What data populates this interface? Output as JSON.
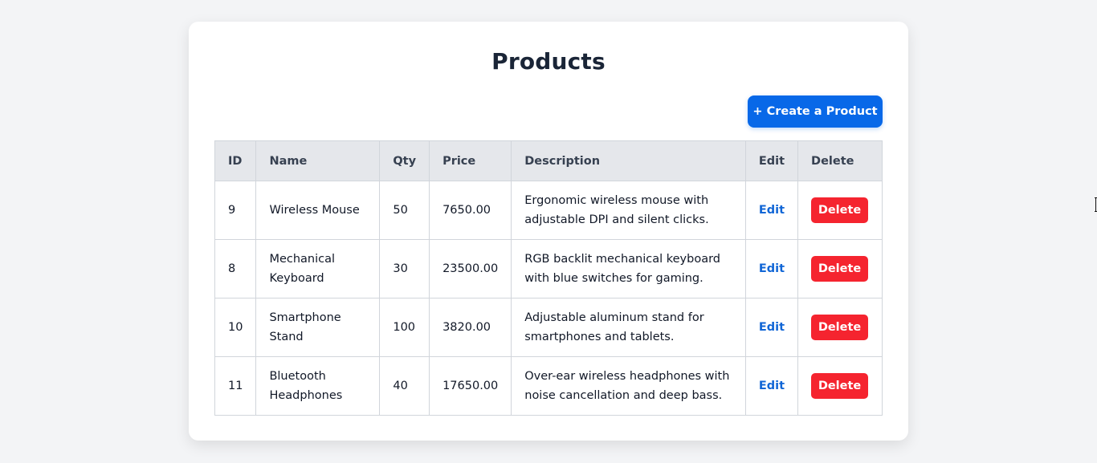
{
  "page": {
    "title": "Products",
    "create_button_label": "+ Create a Product"
  },
  "table": {
    "headers": [
      "ID",
      "Name",
      "Qty",
      "Price",
      "Description",
      "Edit",
      "Delete"
    ],
    "rows": [
      {
        "id": "9",
        "name": "Wireless Mouse",
        "qty": "50",
        "price": "7650.00",
        "description": "Ergonomic wireless mouse with adjustable DPI and silent clicks.",
        "edit_label": "Edit",
        "delete_label": "Delete"
      },
      {
        "id": "8",
        "name": "Mechanical Keyboard",
        "qty": "30",
        "price": "23500.00",
        "description": "RGB backlit mechanical keyboard with blue switches for gaming.",
        "edit_label": "Edit",
        "delete_label": "Delete"
      },
      {
        "id": "10",
        "name": "Smartphone Stand",
        "qty": "100",
        "price": "3820.00",
        "description": "Adjustable aluminum stand for smartphones and tablets.",
        "edit_label": "Edit",
        "delete_label": "Delete"
      },
      {
        "id": "11",
        "name": "Bluetooth Headphones",
        "qty": "40",
        "price": "17650.00",
        "description": "Over-ear wireless headphones with noise cancellation and deep bass.",
        "edit_label": "Edit",
        "delete_label": "Delete"
      }
    ]
  },
  "colors": {
    "page_background": "#f3f4f6",
    "card_background": "#ffffff",
    "primary_button": "#0868e8",
    "delete_button": "#f5242f",
    "edit_link": "#1166d6",
    "header_background": "#e5e7eb"
  },
  "icons": {
    "cursor": "text-cursor-icon"
  }
}
